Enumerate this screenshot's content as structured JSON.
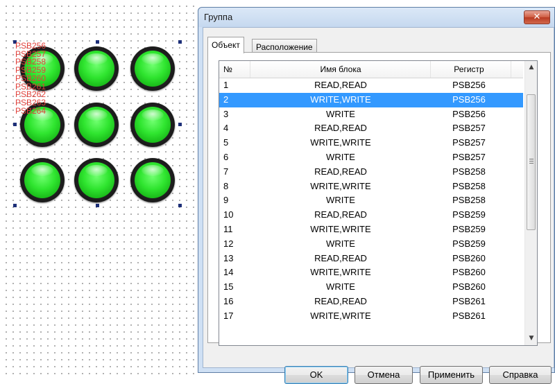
{
  "canvas": {
    "psb_labels": [
      "PSB256",
      "PSB257",
      "PSB258",
      "PSB259",
      "PSB260",
      "PSB261",
      "PSB262",
      "PSB263",
      "PSB264"
    ],
    "lamp_color": "#2fe52f"
  },
  "dialog": {
    "title": "Группа",
    "close_glyph": "✕",
    "tabs": [
      {
        "label": "Объект",
        "active": true
      },
      {
        "label": "Расположение",
        "active": false
      }
    ],
    "table": {
      "headers": [
        "№",
        "Имя блока",
        "Регистр"
      ],
      "selected_index": 1,
      "rows": [
        {
          "num": "1",
          "name": "READ,READ",
          "reg": "PSB256"
        },
        {
          "num": "2",
          "name": "WRITE,WRITE",
          "reg": "PSB256"
        },
        {
          "num": "3",
          "name": "WRITE",
          "reg": "PSB256"
        },
        {
          "num": "4",
          "name": "READ,READ",
          "reg": "PSB257"
        },
        {
          "num": "5",
          "name": "WRITE,WRITE",
          "reg": "PSB257"
        },
        {
          "num": "6",
          "name": "WRITE",
          "reg": "PSB257"
        },
        {
          "num": "7",
          "name": "READ,READ",
          "reg": "PSB258"
        },
        {
          "num": "8",
          "name": "WRITE,WRITE",
          "reg": "PSB258"
        },
        {
          "num": "9",
          "name": "WRITE",
          "reg": "PSB258"
        },
        {
          "num": "10",
          "name": "READ,READ",
          "reg": "PSB259"
        },
        {
          "num": "11",
          "name": "WRITE,WRITE",
          "reg": "PSB259"
        },
        {
          "num": "12",
          "name": "WRITE",
          "reg": "PSB259"
        },
        {
          "num": "13",
          "name": "READ,READ",
          "reg": "PSB260"
        },
        {
          "num": "14",
          "name": "WRITE,WRITE",
          "reg": "PSB260"
        },
        {
          "num": "15",
          "name": "WRITE",
          "reg": "PSB260"
        },
        {
          "num": "16",
          "name": "READ,READ",
          "reg": "PSB261"
        },
        {
          "num": "17",
          "name": "WRITE,WRITE",
          "reg": "PSB261"
        }
      ]
    },
    "buttons": {
      "ok": "OK",
      "cancel": "Отмена",
      "apply": "Применить",
      "help": "Справка"
    },
    "colors": {
      "selection": "#3399ff",
      "frame": "#cfe0f4"
    }
  }
}
